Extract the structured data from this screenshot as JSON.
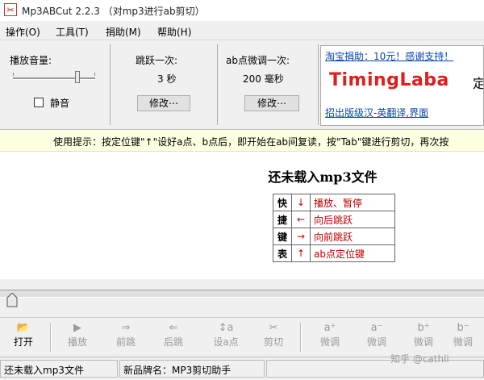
{
  "window": {
    "app_icon_glyph": "✂",
    "title": "Mp3ABCut 2.2.3  （对mp3进行ab剪切）"
  },
  "menu": [
    "操作(O)",
    "工具(T)",
    "捐助(M)",
    "帮助(H)"
  ],
  "volume": {
    "label": "播放音量:",
    "level_percent": 80,
    "mute_label": "静音",
    "mute_checked": false
  },
  "jump": {
    "label": "跳跃一次:",
    "value": "3  秒",
    "button": "修改⋯"
  },
  "fine_tune": {
    "label": "ab点微调一次:",
    "value": "200  毫秒",
    "button": "修改⋯"
  },
  "ad": {
    "donate_link": "淘宝捐助：10元！感谢支持！",
    "brand_logo": "TimingLaba",
    "brand_suffix": "定",
    "pro_link": "招出版级汉-英翻译,界面"
  },
  "hint": "使用提示：按定位键\"↑\"设好a点、b点后，即开始在ab间复读，按\"Tab\"键进行剪切，再次按",
  "main": {
    "status_heading": "还未载入mp3文件",
    "shortcuts": {
      "labels": [
        "快",
        "捷",
        "键",
        "表"
      ],
      "rows": [
        {
          "key": "↓",
          "desc": "播放、暂停"
        },
        {
          "key": "←",
          "desc": "向后跳跃"
        },
        {
          "key": "→",
          "desc": "向前跳跃"
        },
        {
          "key": "↑",
          "desc": "ab点定位键"
        }
      ]
    }
  },
  "toolbar": [
    {
      "icon": "open-folder-icon",
      "glyph": "📂",
      "label": "打开",
      "enabled": true
    },
    {
      "icon": "play-icon",
      "glyph": "▶",
      "label": "播放",
      "enabled": false
    },
    {
      "icon": "forward-icon",
      "glyph": "⇒",
      "label": "前跳",
      "enabled": false
    },
    {
      "icon": "backward-icon",
      "glyph": "⇐",
      "label": "后跳",
      "enabled": false
    },
    {
      "icon": "set-a-icon",
      "glyph": "↕a",
      "label": "设a点",
      "enabled": false
    },
    {
      "icon": "scissors-icon",
      "glyph": "✂",
      "label": "剪切",
      "enabled": false
    },
    {
      "icon": "a-plus-icon",
      "glyph": "a⁺",
      "label": "微调",
      "enabled": false
    },
    {
      "icon": "a-minus-icon",
      "glyph": "a⁻",
      "label": "微调",
      "enabled": false
    },
    {
      "icon": "b-plus-icon",
      "glyph": "b⁺",
      "label": "微调",
      "enabled": false
    },
    {
      "icon": "b-minus-icon",
      "glyph": "b⁻",
      "label": "微调",
      "enabled": false
    }
  ],
  "statusbar": {
    "file_status": "还未载入mp3文件",
    "product_name": "新品牌名：MP3剪切助手"
  },
  "watermark": "知乎 @cathli",
  "colors": {
    "hint_background": "#ffffe1",
    "brand_red": "#e01e1e",
    "link_blue": "#0645ad",
    "shortcut_red": "#c00000"
  }
}
